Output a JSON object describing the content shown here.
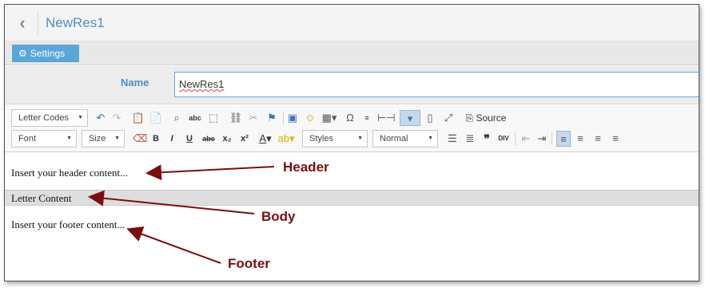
{
  "header": {
    "title": "NewRes1",
    "back_icon": "chevron-left-icon"
  },
  "settings": {
    "label": "Settings",
    "icon": "gear-icon"
  },
  "name_field": {
    "label": "Name",
    "value": "NewRes1"
  },
  "toolbar": {
    "letter_codes": "Letter Codes",
    "font": "Font",
    "size": "Size",
    "styles": "Styles",
    "format": "Normal",
    "source": "Source",
    "bold": "B",
    "italic": "I",
    "underline": "U",
    "strike": "abc",
    "subscript": "x₂",
    "superscript": "x²",
    "text_color": "A",
    "omega": "Ω"
  },
  "content": {
    "header_text": "Insert your header content...",
    "body_text": "Letter Content",
    "footer_text": "Insert your footer content..."
  },
  "annotations": {
    "header": "Header",
    "body": "Body",
    "footer": "Footer",
    "color": "#7a0e0e"
  },
  "colors": {
    "accent": "#4f8ec2",
    "settings_button": "#5aa6d6"
  }
}
